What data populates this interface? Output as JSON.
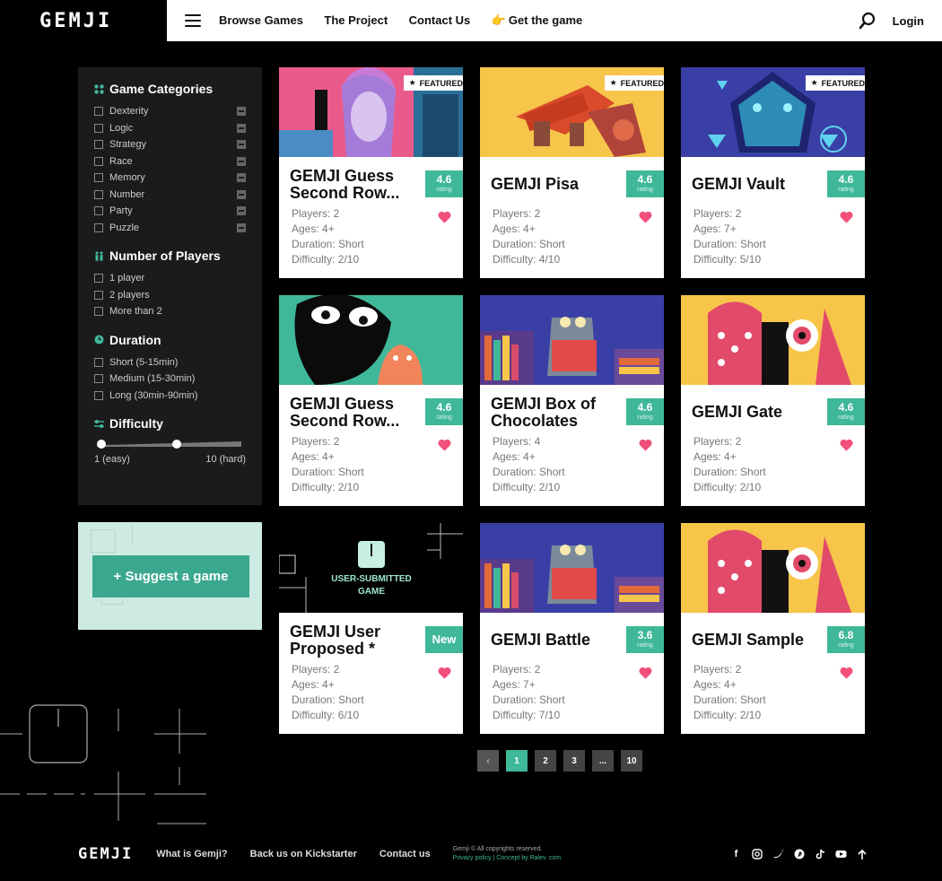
{
  "header": {
    "logo": "GEMJI",
    "nav": [
      "Browse Games",
      "The Project",
      "Contact Us",
      "Get the game"
    ],
    "login": "Login"
  },
  "sidebar": {
    "categories": {
      "title": "Game Categories",
      "items": [
        "Dexterity",
        "Logic",
        "Strategy",
        "Race",
        "Memory",
        "Number",
        "Party",
        "Puzzle"
      ]
    },
    "players": {
      "title": "Number of Players",
      "items": [
        "1 player",
        "2 players",
        "More than 2"
      ]
    },
    "duration": {
      "title": "Duration",
      "items": [
        "Short (5-15min)",
        "Medium (15-30min)",
        "Long (30min-90min)"
      ]
    },
    "difficulty": {
      "title": "Difficulty",
      "min_label": "1 (easy)",
      "max_label": "10 (hard)",
      "range_low": 1,
      "range_high": 6
    }
  },
  "suggest": {
    "label": "+ Suggest a game"
  },
  "user_submitted": {
    "label": "USER-SUBMITTED GAME"
  },
  "cards": [
    {
      "title": "GEMJI Guess Second Row...",
      "badge": "FEATURED",
      "rating": "4.6",
      "rating_label": "rating",
      "players": "Players: 2",
      "ages": "Ages: 4+",
      "duration": "Duration: Short",
      "difficulty": "Difficulty: 2/10"
    },
    {
      "title": "GEMJI Pisa",
      "badge": "FEATURED",
      "rating": "4.6",
      "rating_label": "rating",
      "players": "Players: 2",
      "ages": "Ages: 4+",
      "duration": "Duration: Short",
      "difficulty": "Difficulty: 4/10"
    },
    {
      "title": "GEMJI Vault",
      "badge": "FEATURED",
      "rating": "4.6",
      "rating_label": "rating",
      "players": "Players: 2",
      "ages": "Ages: 7+",
      "duration": "Duration: Short",
      "difficulty": "Difficulty: 5/10"
    },
    {
      "title": "GEMJI Guess Second Row...",
      "badge": "",
      "rating": "4.6",
      "rating_label": "rating",
      "players": "Players: 2",
      "ages": "Ages: 4+",
      "duration": "Duration: Short",
      "difficulty": "Difficulty: 2/10"
    },
    {
      "title": "GEMJI Box of Chocolates",
      "badge": "",
      "rating": "4.6",
      "rating_label": "rating",
      "players": "Players: 4",
      "ages": "Ages: 4+",
      "duration": "Duration: Short",
      "difficulty": "Difficulty: 2/10"
    },
    {
      "title": "GEMJI Gate",
      "badge": "",
      "rating": "4.6",
      "rating_label": "rating",
      "players": "Players: 2",
      "ages": "Ages: 4+",
      "duration": "Duration: Short",
      "difficulty": "Difficulty: 2/10"
    },
    {
      "title": "GEMJI User Proposed *",
      "badge": "",
      "rating": "New",
      "rating_label": "",
      "players": "Players: 2",
      "ages": "Ages: 4+",
      "duration": "Duration: Short",
      "difficulty": "Difficulty: 6/10"
    },
    {
      "title": "GEMJI Battle",
      "badge": "",
      "rating": "3.6",
      "rating_label": "rating",
      "players": "Players: 2",
      "ages": "Ages: 7+",
      "duration": "Duration: Short",
      "difficulty": "Difficulty: 7/10"
    },
    {
      "title": "GEMJI Sample",
      "badge": "",
      "rating": "6.8",
      "rating_label": "rating",
      "players": "Players: 2",
      "ages": "Ages: 4+",
      "duration": "Duration: Short",
      "difficulty": "Difficulty: 2/10"
    }
  ],
  "pagination": {
    "pages": [
      "1",
      "2",
      "3",
      "...",
      "10"
    ],
    "active": "1"
  },
  "footer": {
    "logo": "GEMJI",
    "links": [
      "What is Gemji?",
      "Back us on Kickstarter",
      "Contact us"
    ],
    "copyright": "Gemji © All copyrights reserved.",
    "privacy": "Privacy policy",
    "separator": " | ",
    "credit": "Concept by Ralev. com"
  },
  "colors": {
    "accent": "#3fb89a",
    "heart": "#f0507a",
    "background": "#000000",
    "sidebar": "#1b1b1b"
  }
}
